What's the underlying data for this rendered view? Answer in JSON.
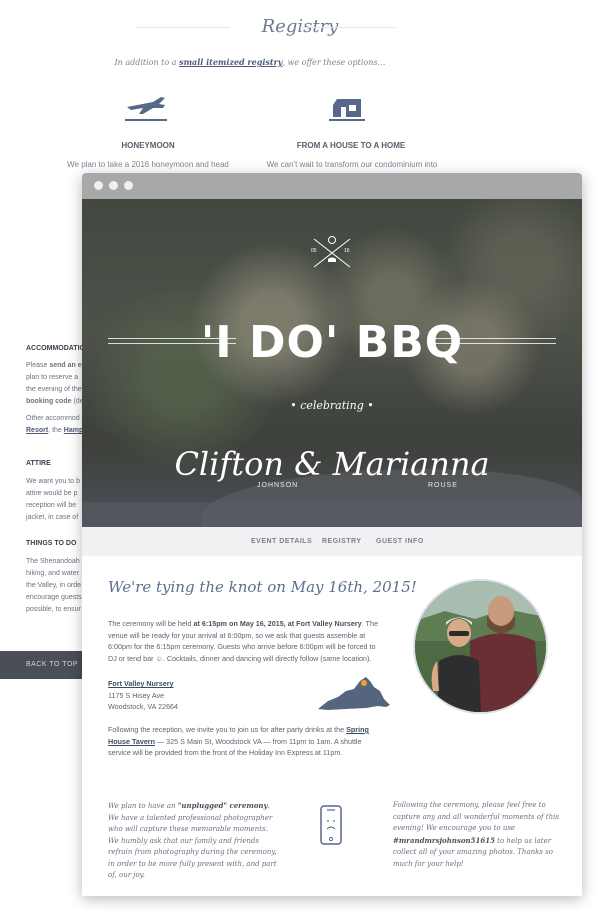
{
  "registry": {
    "title": "Registry",
    "intro_before": "In addition to a ",
    "intro_link": "small itemized registry",
    "intro_after": ", we offer these options…",
    "options": [
      {
        "icon": "airplane-icon",
        "title": "HONEYMOON",
        "text": "We plan to take a 2016 honeymoon and head"
      },
      {
        "icon": "house-icon",
        "title": "FROM A HOUSE TO A HOME",
        "text": "We can't wait to transform our condominium into"
      }
    ]
  },
  "background_sidebar": {
    "accommodations_heading": "ACCOMMODATIO",
    "acc_line1_a": "Please ",
    "acc_line1_b": "send an e",
    "acc_line2": "plan to reserve a",
    "acc_line3": "the evening of the",
    "acc_line4_b": "booking code",
    "acc_line4_rest": " (de",
    "other_line": "Other accommod",
    "resort_a": "Resort",
    "resort_b": ", the ",
    "resort_c": "Hamp",
    "attire_heading": "ATTIRE",
    "attire_lines": [
      "We want you to b",
      "attire would be p",
      "reception will be",
      "jacket, in case of"
    ],
    "things_heading": "THINGS TO DO",
    "things_lines": [
      "The Shenandoah",
      "hiking, and water",
      "the Valley, in orde",
      "encourage guests",
      "possible, to ensur"
    ],
    "back_to_top": "BACK TO TOP"
  },
  "hero": {
    "emblem_left": "05",
    "emblem_right": "16",
    "title": "'I DO' BBQ",
    "celebrating": "• celebrating •",
    "names": "Clifton & Marianna",
    "surname_left": "JOHNSON",
    "surname_right": "ROUSE"
  },
  "nav": {
    "items": [
      "EVENT DETAILS",
      "REGISTRY",
      "GUEST INFO"
    ]
  },
  "details": {
    "heading": "We're tying the knot on May 16th, 2015!",
    "p1_a": "The ceremony will be held ",
    "p1_b": "at 6:15pm on May 16, 2015, at Fort Valley Nursery",
    "p1_c": ". The venue will be ready for your arrival at 6:00pm, so we ask that guests assemble at 6:00pm for the 6:15pm ceremony. Guests who arrive before 6:00pm will be forced to DJ or tend bar ☺. Cocktails, dinner and dancing will directly follow (same location).",
    "venue_name": "Fort Valley Nursery",
    "venue_street": "1175 S Hisey Ave",
    "venue_city": "Woodstock, VA 22664",
    "p2_a": "Following the reception, we invite you to join us for after party drinks at the ",
    "p2_link": "Spring House Tavern",
    "p2_b": " — 325 S Main St, Woodstock VA — from 11pm to 1am. A shuttle service will be provided from the front of the Holiday Inn Express at 11pm.",
    "state_icon": "virginia-map-icon"
  },
  "unplugged": {
    "left_a": "We plan to have an ",
    "left_b": "\"unplugged\" ceremony",
    "left_c": ". We have a talented professional photographer who will capture these memorable moments. We humbly ask that our family and friends refrain from photography during the ceremony, in order to be more fully present with, and part of, our joy.",
    "right_a": "Following the ceremony, please feel free to capture any and all wonderful moments of this evening! We encourage you to use ",
    "right_b": "#mrandmrsjohnson51615",
    "right_c": " to help us later collect all of your amazing photos. Thanks so much for your help!"
  }
}
